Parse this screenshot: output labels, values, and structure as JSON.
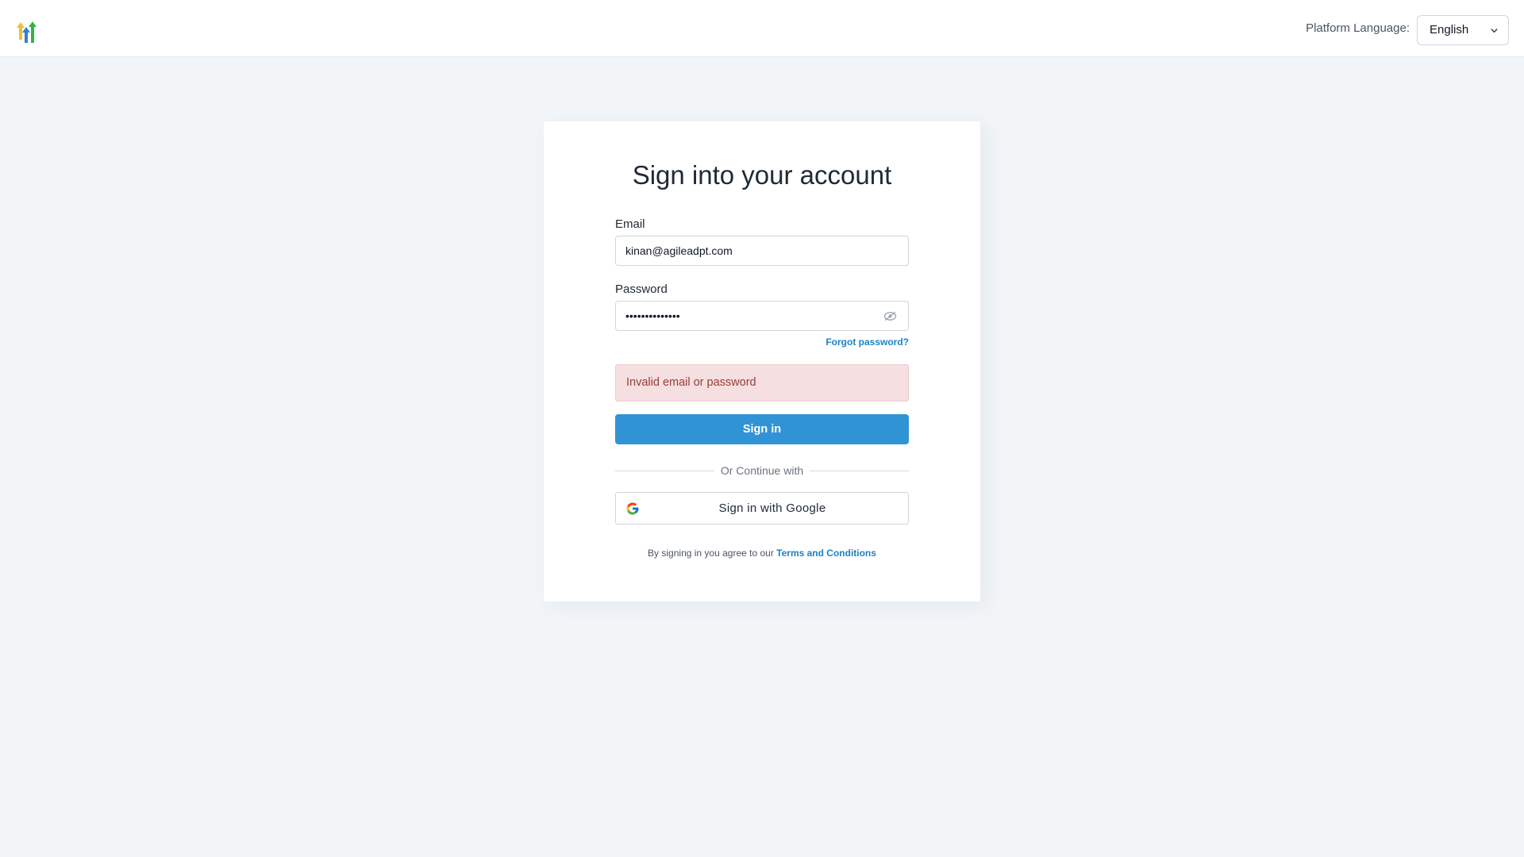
{
  "header": {
    "logo_icon": "highlevel-arrows-logo-icon",
    "language_label": "Platform Language:",
    "language_value": "English",
    "dropdown_icon": "chevron-down-icon"
  },
  "login": {
    "title": "Sign into your account",
    "email_label": "Email",
    "email_value": "kinan@agileadpt.com",
    "password_label": "Password",
    "password_value": "••••••••••••••",
    "password_toggle_icon": "eye-icon",
    "forgot_password": "Forgot password?",
    "error_message": "Invalid email or password",
    "sign_in_button": "Sign in",
    "divider_text": "Or Continue with",
    "google_button": "Sign in with Google",
    "google_icon": "google-g-icon",
    "terms_prefix": "By signing in you agree to our",
    "terms_link": "Terms and Conditions"
  },
  "colors": {
    "background": "#f1f5f8",
    "primary": "#3093d6",
    "link": "#1c82c7",
    "error_bg": "#f5dfe1",
    "error_text": "#9a3b35"
  }
}
